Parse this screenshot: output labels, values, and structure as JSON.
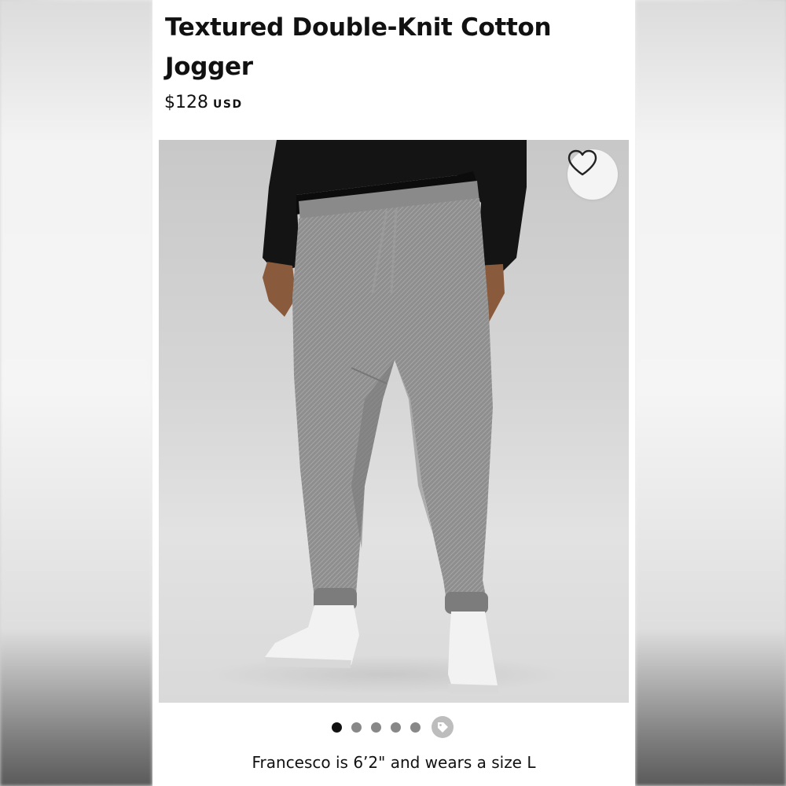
{
  "product": {
    "title_line1": "Textured Double-Knit Cotton",
    "title_line2": "Jogger",
    "price_amount": "$128",
    "price_currency": "USD"
  },
  "image": {
    "subject": "grey textured jogger pants with black long-sleeve top and white sneakers",
    "wishlist_icon": "heart-icon"
  },
  "carousel": {
    "total_dots": 5,
    "active_index": 0,
    "extra_icon": "price-tag-icon"
  },
  "model_note": "Francesco is 6’2\" and wears a size L",
  "colors": {
    "active_dot": "#111111",
    "inactive_dot": "#888888",
    "pant_grey": "#8e8e8e",
    "top_black": "#141414"
  }
}
